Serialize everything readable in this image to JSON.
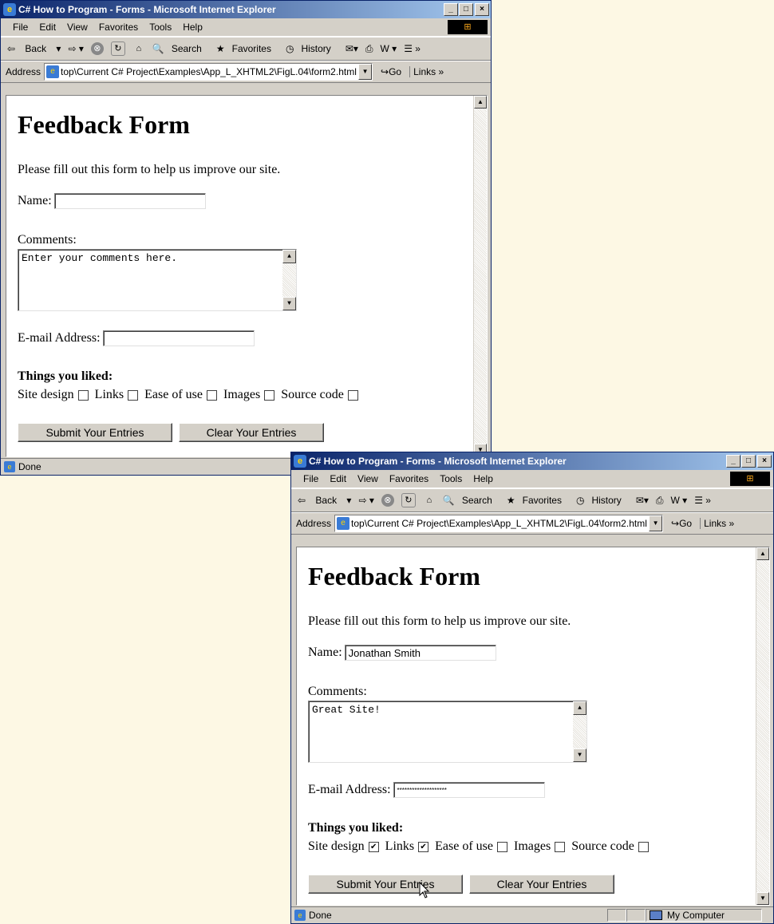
{
  "windows": [
    {
      "title": "C# How to Program - Forms - Microsoft Internet Explorer",
      "menu": [
        "File",
        "Edit",
        "View",
        "Favorites",
        "Tools",
        "Help"
      ],
      "toolbar": {
        "back": "Back",
        "search": "Search",
        "favorites": "Favorites",
        "history": "History"
      },
      "address_label": "Address",
      "address_value": "top\\Current C# Project\\Examples\\App_L_XHTML2\\FigL.04\\form2.html",
      "go_label": "Go",
      "links_label": "Links",
      "page": {
        "heading": "Feedback Form",
        "intro": "Please fill out this form to help us improve our site.",
        "name_label": "Name:",
        "name_value": "",
        "comments_label": "Comments:",
        "comments_value": "Enter your comments here.",
        "email_label": "E-mail Address:",
        "email_value": "",
        "liked_label": "Things you liked:",
        "options": [
          {
            "label": "Site design",
            "checked": false
          },
          {
            "label": "Links",
            "checked": false
          },
          {
            "label": "Ease of use",
            "checked": false
          },
          {
            "label": "Images",
            "checked": false
          },
          {
            "label": "Source code",
            "checked": false
          }
        ],
        "submit_label": "Submit Your Entries",
        "clear_label": "Clear Your Entries"
      },
      "status": "Done",
      "zone": ""
    },
    {
      "title": "C# How to Program - Forms - Microsoft Internet Explorer",
      "menu": [
        "File",
        "Edit",
        "View",
        "Favorites",
        "Tools",
        "Help"
      ],
      "toolbar": {
        "back": "Back",
        "search": "Search",
        "favorites": "Favorites",
        "history": "History"
      },
      "address_label": "Address",
      "address_value": "top\\Current C# Project\\Examples\\App_L_XHTML2\\FigL.04\\form2.html",
      "go_label": "Go",
      "links_label": "Links",
      "page": {
        "heading": "Feedback Form",
        "intro": "Please fill out this form to help us improve our site.",
        "name_label": "Name:",
        "name_value": "Jonathan Smith",
        "comments_label": "Comments:",
        "comments_value": "Great Site!",
        "email_label": "E-mail Address:",
        "email_value": "********************",
        "liked_label": "Things you liked:",
        "options": [
          {
            "label": "Site design",
            "checked": true
          },
          {
            "label": "Links",
            "checked": true
          },
          {
            "label": "Ease of use",
            "checked": false
          },
          {
            "label": "Images",
            "checked": false
          },
          {
            "label": "Source code",
            "checked": false
          }
        ],
        "submit_label": "Submit Your Entries",
        "clear_label": "Clear Your Entries"
      },
      "status": "Done",
      "zone": "My Computer"
    }
  ]
}
